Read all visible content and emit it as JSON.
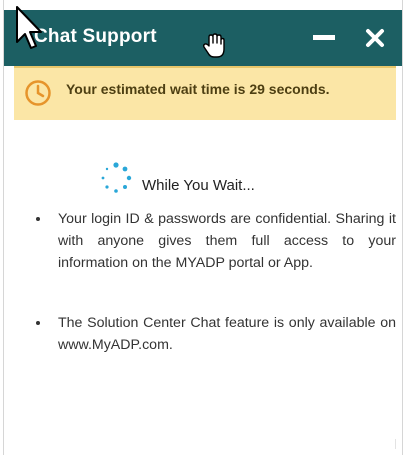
{
  "header": {
    "title": "Chat Support",
    "minimize_icon": "minimize-icon",
    "close_icon": "close-icon",
    "color": "#1c5f63"
  },
  "wait_banner": {
    "icon": "clock-icon",
    "text": "Your estimated wait time is 29 seconds.",
    "background": "#fbe6a6",
    "icon_color": "#e6942b"
  },
  "content": {
    "spinner_icon": "loading-spinner-icon",
    "heading": "While You Wait...",
    "tips": [
      "Your login ID & passwords are confidential. Sharing it with anyone gives them full access to your information on the MYADP portal or App.",
      "The Solution Center Chat  feature is only available on www.MyADP.com."
    ]
  }
}
